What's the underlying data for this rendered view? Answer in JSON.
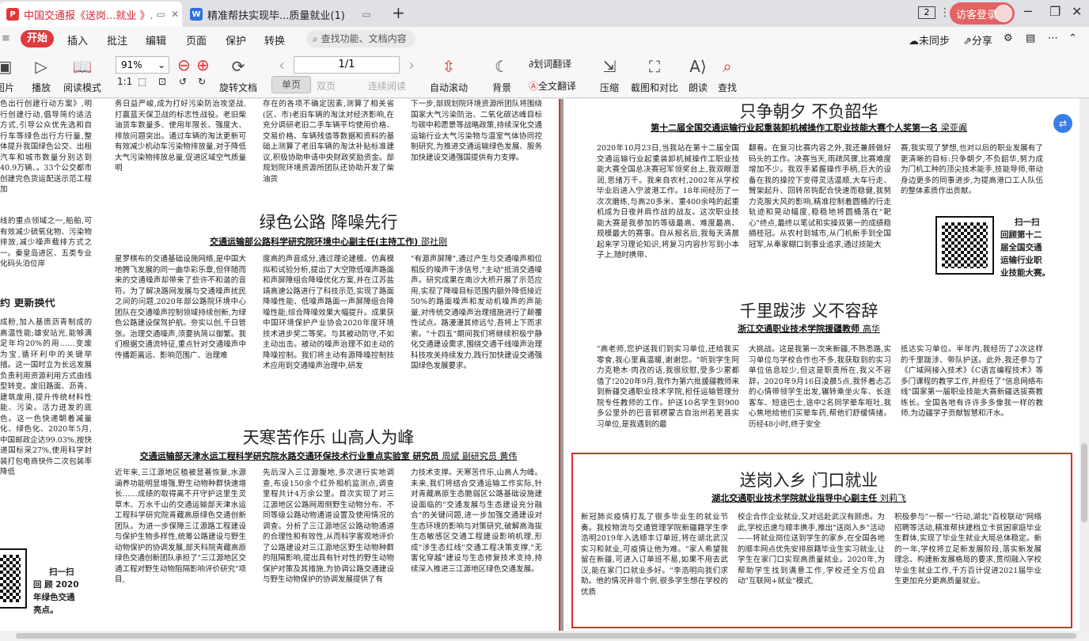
{
  "tabs": [
    {
      "label": "中国交通报《送岗...就业 》.pdf",
      "icon": "pdf-icon",
      "badge": "P"
    },
    {
      "label": "精准帮扶实现毕...质量就业(1)",
      "icon": "word-icon",
      "badge": "W"
    }
  ],
  "titlebar": {
    "count": "2",
    "login": "访客登录"
  },
  "menu": {
    "start": "开始",
    "items": [
      "插入",
      "批注",
      "编辑",
      "页面",
      "保护",
      "转换"
    ],
    "search": "查找功能、文档内容",
    "sync": "未同步",
    "share": "分享"
  },
  "toolbar": {
    "items": [
      "图片",
      "播放",
      "阅读模式",
      "旋转文档",
      "自动滚动",
      "背景",
      "划词翻译",
      "全文翻译",
      "压缩",
      "截图和对比",
      "朗读",
      "查找"
    ],
    "zoom": "91%",
    "page": "1/1",
    "single": "单页",
    "double": "双页",
    "continuous": "连续阅读"
  },
  "left_page": {
    "frag_top": "色出行创建行动方案》,明行创建行动,倡导简约适活方式,引导公众优先选和自行车等绿色出行方行量,整体提升我国绿色公交、出租汽车和城市数量分别达到40.9万辆、。33个公交都市创建完色货运配送示范工程加",
    "frag_mid": "线的重点领域之一,船舶,可有效减少硫氧化物、污染物排放,减少噪声载排方式之一。秦皇岛进区、五类专业化码头泊位岸",
    "frag_head": "约 更新换代",
    "frag_low": "成粉,加入基质沥青制成的高温性能;雄安站光,能够满足年均20%的用……变废为宝,循环利中的关键举措。这一国时立为长远发展负责利用资源利用方式由线型转变。废旧路面、沥青、建筑废用,提升传统材料性能、污染。活力迸发的底色。这一色快递朝着减量化、绿色化、2020年5月,中国邮政企达99.03%,按快递国标采27%,使用科学封装打包电商快件二次包装率降低",
    "scan_left": [
      "扫一扫",
      "回 顾 2020",
      "年绿色交通",
      "亮点。"
    ],
    "colA_top": "务日益严峻,成为打好污染防治攻坚战,打赢蓝天保卫战的标志性战役。老旧柴油货车数量多、使用年限长、强度大、排放问题突出。通过车辆的淘汰更新可有效减少机动车污染物排放量,对于降低大气污染物排放总量,促进区域空气质量明",
    "colB_top": "存在的各项不确定因素,测算了相关省(区、市)老旧车辆的淘汰对经济影响,在充分调研老旧二手车辆平均使用价格、交易价格、车辆残值等数据和资料的基础上测算了老旧车辆的淘汰补贴标准建议,积极协助申请中央财政奖励资金。部规划院环境资源所团队还协助开发了柴油货",
    "colC_top": "下一步,部规划院环境资源所团队将围绕国家大气污染防治、二氧化碳达峰目标与碳中和愿景等战略政策,持续深化交通运输行业大气污染物与温室气体协同控制研究,为推进交通运输绿色发展、服务加快建设交通强国提供有力支撑。",
    "green": {
      "title": "绿色公路 降噪先行",
      "byline": "交通运输部公路科学研究院环境中心副主任(主持工作)",
      "name": "邵社刚",
      "c1": "星罗棋布的交通基础设施网络,是中国大地腾飞发展的同一曲华彩乐章,但伴随而来的交通噪声却带来了些许不和谐的音符。为了解决路网发展与交通噪声扰民之间的问题,2020年部公路院环境中心团队在交通噪声控制领域持续创新,为绿色公路建设保驾护航。夯实以创,千日管张。治理交通噪声,须要执简以御繁。我们根据交通流特征,重点针对交通噪声中传播距离远、影响范围广、治理难",
      "c2": "度高的声音成分,通过理论建模、仿真模拟和试验分析,提出了大空隙低噪声路面和声屏障组合降噪优化方案,并在江苏盐靖高速公路进行了科技示范,实现了路面降噪性能、低噪声路面一声屏障组合降噪性能,综合降噪效果大幅提升。成果获中国环境保护产业协会2020年度环境技术进步奖二等奖。与其被动防守,不如主动出击。被动的噪声治理不如主动的降噪控制。我们将主动有源降噪控制技术应用到交通噪声治理中,研发",
      "c3": "\"有源声屏障\",通过产生与交通噪声相位相反的噪声干涉信号,\"主动\"抵消交通噪声。研究成果在南沙大桥开展了示范应用,实现了降噪目标范围内额外降低接近50%的路面噪声和发动机噪声的声能量,对传统交通噪声治理措施进行了颠覆性试点。路漫漫其修远兮,吾将上下而求索。\"十四五\"期间我们将继续积极宁静化交通建设需求,围绕交通干线噪声治理科技攻关持续发力,践行加快建设交通强国绿色发展要求。"
    },
    "cold": {
      "title": "天寒苦作乐 山高人为峰",
      "byline": "交通运输部天津水运工程科学研究院水路交通环保技术行业重点实验室 研究员",
      "name": "周斌 副研究员 黄伟",
      "c1": "近年来,三江源地区植被显著恢复,水源涵养功能明显增强,野生动物种群快速增长……成绩的取得离不开守护这里生灵草木、万水千山的交通运输部天津水运工程科学研究院青藏高原绿色交通创新团队。为进一步保障三江源路工程建设与保护生物多样性,统筹公路建设与野生动物保护的协调发展,部天科院青藏高原绿色交通创新团队承担了\"三江源地区交通工程对野生动物阻隔影响评价研究\"项目,",
      "c2": "先后深入三江源腹地,多次进行实地调查,布设150余个红外相机监测点,调查里程共计4万余公里。首次实现了对三江源地区公路网周侧野生动物分布、不同等级公路动物通道设置及使用情况的调查。分析了三江源地区公路动物通道的合理性和有效性,从而科学客观地评价了公路建设对三江源地区野生动物种群的阻隔影响,提出具有针对性的野生动物保护对策及其措施,为协调公路交通建设与野生动物保护的协调发展提供了有",
      "c3": "力技术支撑。天寒苦作乐,山高人为峰。未来,我们将结合交通运输工作实际,针对青藏高原生态脆弱区公路基础设施建设面临的\"交通发展与生态建设充分融合\"的关键问题,进一步加强交通建设对生态环境的影响与对策研究,破解高海拔生态敏感区交通工程建设影响机理,形成\"涉生态红线\"交通工程决策支撑,\"无害化穿越\"建设与生态修复技术支持,持续深入推进三江源地区绿色交通发展。"
    }
  },
  "right_page": {
    "sec1": {
      "title": "只争朝夕 不负韶华",
      "byline": "第十二届全国交通运输行业起重装卸机械操作工职业技能大赛个人奖第一名",
      "name": "梁亚阗",
      "c1": "2020年10月23日,当我站在第十二届全国交通运输行业起重装卸机械操作工职业技能大赛全国总决赛冠军领奖台上,我双眼湿润,思绪万千。我来自农村,2002年从学校毕业后进入宁波港工作。18年间经历了一次次磨练,与高20多米、重400余吨的起重机成为日夜并肩作战的战友。这次职业技能大赛是我参加的等级最高、难度最高、规模最大的赛事。自从报名后,我每天清晨起来学习理论知识,将复习内容抄写到小本子上,随时携带、",
      "c2": "翻看。在复习比赛内容之外,我还兼顾做好码头的工作。决赛当天,雨疏风骤,比赛难度增加不少。我双手紧握操作手柄,巨大的设备在我的操控下变得灵活温顺,大车行走、臂架起升、回转吊钩配合快速而稳健,我努力克服大风的影响,精准控制着圆桶的行走轨迹和晃动幅度,稳稳地将圆桶落在\"靶心\"终点,最终以笔试和实操双第一的成绩稳摘桂冠。从农村到城市,从门机新手到全国冠军,从奉家糊口到事业追求,通过技能大",
      "c3": "赛,我实现了梦想,也对以后的职业发展有了更清晰的目标:只争朝夕,不负韶华,努力成为门机工种的顶尖技术能手,技能导师,带动身边更多的同事进步,为提高港口工人队伍的整体素质作出贡献。",
      "scan": [
        "扫一扫",
        "回顾第十二",
        "届全国交通",
        "运输行业职",
        "业技能大赛。"
      ]
    },
    "sec2": {
      "title": "千里跋涉 义不容辞",
      "byline": "浙江交通职业技术学院援疆教师",
      "name": "高华",
      "c1": "\"高老师,您护送我们到实习单位,还给我买零食,我心里真温暖,谢谢您。\"听到学生阿力克艳木·肉孜的话,我很欣慰,受多少累都值了!2020年9月,我作为第六批援疆教师来到新疆交通职业技术学院,担任运输管理分院专任教师的工作。护送10名学生到900多公里外的巴音郭楞蒙古自治州若羌县实习单位,是我遇到的最",
      "c2": "大挑战。这是我第一次来新疆,不熟悉路,实习单位与学校合作也不多,我获取到的实习单位信息较少,但这是职责所在,我义不容辞。2020年9月16日凌晨5点,我怀着忐忑的心情带领学生出发,辗转乘坐火车、长途客车、短途巴士,途中2名同学晕车呕吐,我心焦地给他们买晕车药,帮他们舒缓情绪。历经48小时,终于安全",
      "c3": "抵达实习单位。半年内,我经历了2次这样的千里跋涉、带队护送。此外,我还参与了《广域网接入技术》《C语言编程技术》等多门课程的教学工作,并担任了\"信息网络布线\"国家第一届职业技能大赛新疆选拔赛教练长。全国各地有许许多多像我一样的教师,为边疆学子贡献智慧和汗水。"
    },
    "sec3": {
      "title": "送岗入乡 门口就业",
      "byline": "湖北交通职业技术学院就业指导中心副主任",
      "name": "刘莉飞",
      "c1": "新冠肺炎疫情打乱了很多毕业生的就业节奏。我校物流与交通管理学院新疆籍学生李浩明2019年入选顺丰订单班,将在湖北武汉实习和就业,可疫情让他为难。\"家人希望我留在新疆,可进入订单班不易,如果不用去武汉,能在家门口就业多好。\"李浩明向我们求助。他的情况并非个例,很多学生想在学校的优质",
      "c2": "校企合作企业就业,又对远赴武汉有顾虑。为此,学校迅速与顺丰携手,推出\"送岗入乡\"活动——将就业岗位送到学生的家乡,在全国各地的顺丰网点优先安排原籍毕业生实习就业,让学生在家门口实现高质量就业。2020年,为帮助学生找到满意工作,学校还全方位启动\"互联网+就业\"模式,",
      "c3": "积极参与\"一帮一\"行动,湖北\"百校联动\"网络招聘等活动,精准帮扶建档立卡贫困家庭毕业生群体,实现了毕业生就业大局总体稳定。新的一年,学校将立足新发展阶段,落实新发展理念、构建新发展格局的要求,贯彻融入学校毕业生就业工作,千方百计促进2021届毕业生更加充分更高质量就业。"
    }
  }
}
